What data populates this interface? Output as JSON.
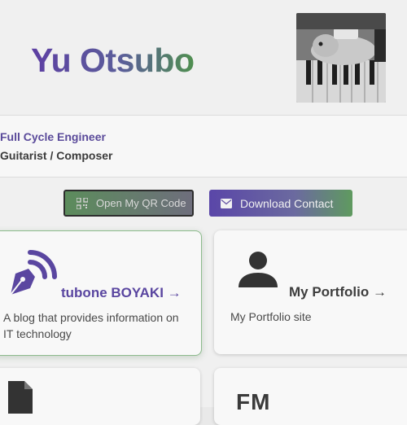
{
  "header": {
    "name": "Yu Otsubo",
    "avatar_alt": "avatar"
  },
  "title_card": {
    "roles": [
      "Full Cycle Engineer",
      "Guitarist / Composer"
    ]
  },
  "buttons": {
    "qr_label": "Open My QR Code",
    "download_label": "Download Contact",
    "qr_icon": "qr-code-icon",
    "download_icon": "envelope-icon"
  },
  "cards": [
    {
      "title": "tubone BOYAKI →",
      "description": "A blog that provides information on IT technology",
      "icon": "fountain-pen-rss-icon"
    },
    {
      "title": "My Portfolio →",
      "description": "My Portfolio site",
      "icon": "person-icon"
    },
    {
      "title": "",
      "description": "",
      "icon": "document-icon"
    },
    {
      "title": "",
      "description": "",
      "icon": "fm-logo-icon",
      "logo_text": "FM"
    }
  ],
  "colors": {
    "accent_purple": "#5a46a0",
    "accent_green": "#4f8f4f",
    "background": "#f0f0f0"
  }
}
